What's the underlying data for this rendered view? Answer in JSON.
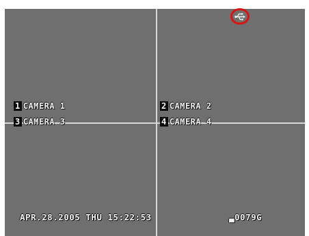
{
  "cameras": [
    {
      "number": "1",
      "label": "CAMERA 1"
    },
    {
      "number": "2",
      "label": "CAMERA 2"
    },
    {
      "number": "3",
      "label": "CAMERA 3"
    },
    {
      "number": "4",
      "label": "CAMERA 4"
    }
  ],
  "status": {
    "datetime": "APR.28.2005 THU 15:22:53",
    "counter": "▃0079G"
  },
  "icons": {
    "usb": "usb-icon",
    "highlight": "red-circle"
  },
  "colors": {
    "screen": "#6f6f6f",
    "divider": "#d8d8d8",
    "highlight": "#e01010"
  }
}
